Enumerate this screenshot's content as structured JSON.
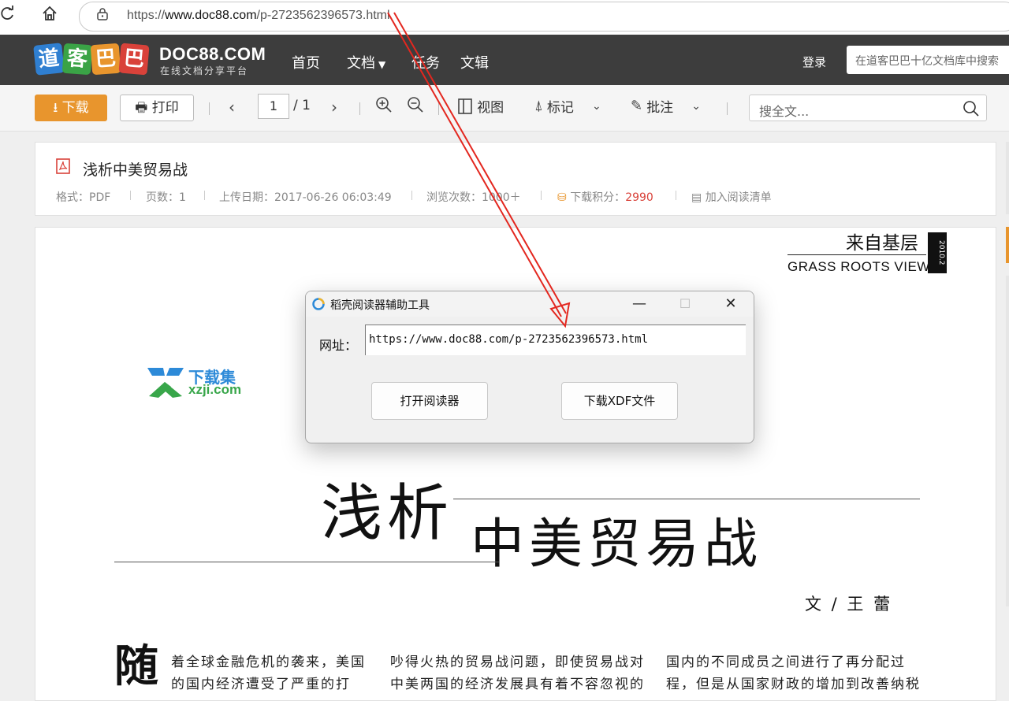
{
  "browser": {
    "url_prefix": "https://",
    "url_host": "www.doc88.com",
    "url_path": "/p-2723562396573.html",
    "reload_icon": "reload-icon",
    "home_icon": "home-icon"
  },
  "site": {
    "logo_chars": [
      "道",
      "客",
      "巴",
      "巴"
    ],
    "logo_colors": [
      "#2f7fd1",
      "#3aa346",
      "#e8952d",
      "#d9423a"
    ],
    "logo_en": "DOC88.COM",
    "logo_sub": "在线文档分享平台",
    "nav": [
      "首页",
      "文档",
      "任务",
      "文辑"
    ],
    "login": "登录",
    "search_placeholder": "在道客巴巴十亿文档库中搜索"
  },
  "toolbar": {
    "download": "下载",
    "print": "打印",
    "page_current": "1",
    "page_total": "/ 1",
    "view": "视图",
    "mark": "标记",
    "annotate": "批注",
    "search_placeholder": "搜全文..."
  },
  "doc_info": {
    "title": "浅析中美贸易战",
    "format": "格式：PDF",
    "pages": "页数：1",
    "upload_date": "上传日期：2017-06-26 06:03:49",
    "views": "浏览次数：1000＋",
    "points_label": "下载积分：",
    "points_value": "2990",
    "add_to_list": "加入阅读清单",
    "accent_color": "#e8952d",
    "points_color": "#d9423a"
  },
  "document": {
    "column_title": "来自基层",
    "column_en": "GRASS  ROOTS  VIEWS",
    "issue": "2010.2",
    "watermark_cn": "下载集",
    "watermark_en": "xzji.com",
    "headline_1": "浅析",
    "headline_2": "中美贸易战",
    "author": "文 / 王  蕾",
    "drop_cap": "随",
    "col1_line1": "着全球金融危机的袭来，美国",
    "col1_line2": "的国内经济遭受了严重的打",
    "col2_line1": "吵得火热的贸易战问题，即使贸易战对",
    "col2_line2": "中美两国的经济发展具有着不容忽视的",
    "col3_line1": "国内的不同成员之间进行了再分配过",
    "col3_line2": "程，但是从国家财政的增加到改善纳税"
  },
  "dialog": {
    "title": "稻壳阅读器辅助工具",
    "minimize": "—",
    "maximize": "☐",
    "close": "✕",
    "url_label": "网址：",
    "url_value": "https://www.doc88.com/p-2723562396573.html",
    "open_button": "打开阅读器",
    "download_button": "下载XDF文件"
  }
}
